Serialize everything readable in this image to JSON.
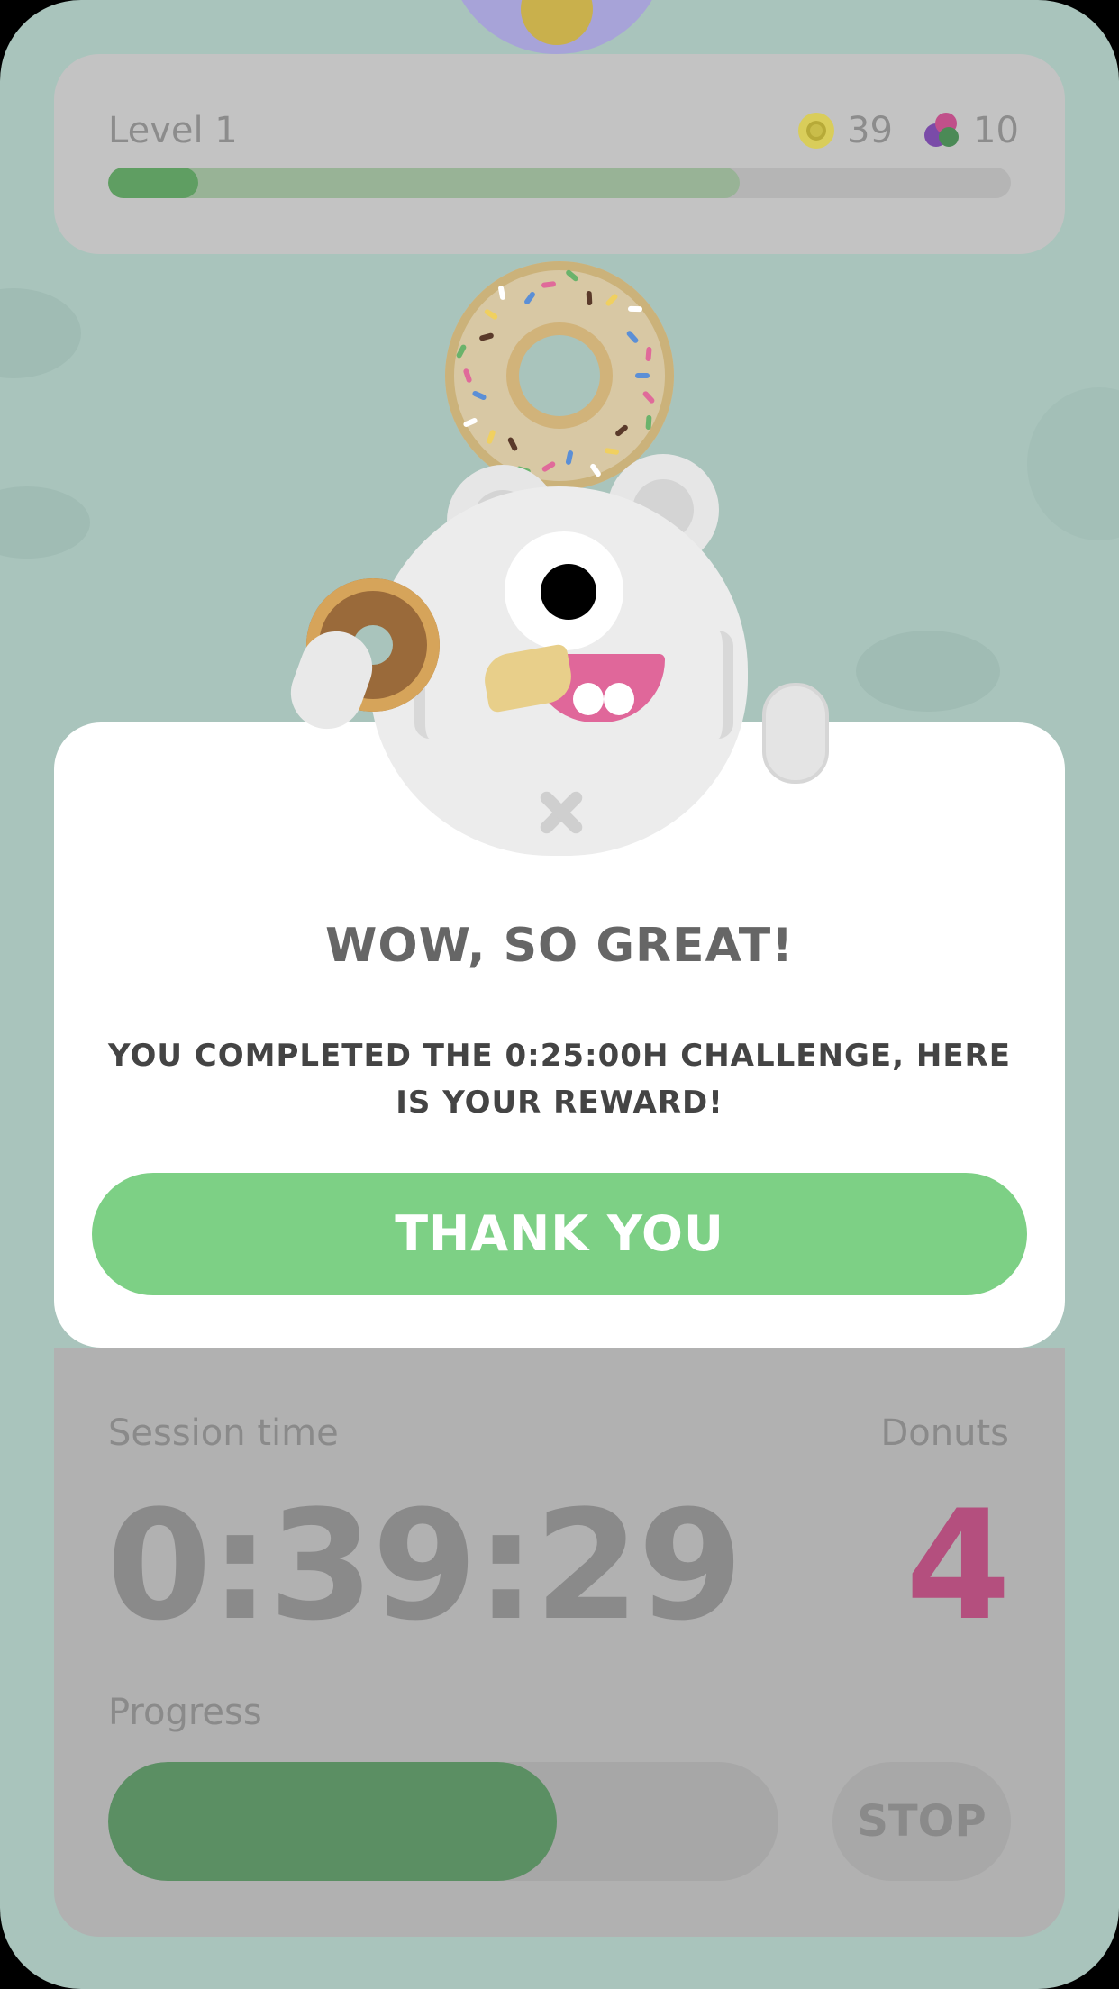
{
  "header": {
    "level_label": "Level 1",
    "coins": "39",
    "gems": "10",
    "level_progress": 0.1,
    "daily_progress": 0.7
  },
  "modal": {
    "title": "WOW, SO GREAT!",
    "message": "YOU COMPLETED THE 0:25:00H CHALLENGE, HERE IS YOUR REWARD!",
    "button_label": "THANK YOU"
  },
  "session": {
    "time_label": "Session time",
    "time_value": "0:39:29",
    "donuts_label": "Donuts",
    "donuts_value": "4",
    "progress_label": "Progress",
    "progress": 0.67,
    "stop_label": "STOP"
  },
  "colors": {
    "accent_green": "#7dd085",
    "donut_count": "#b44f7e",
    "background": "#a9c4bc"
  },
  "icons": {
    "coin": "coin-icon",
    "gem": "gem-icon",
    "mascot": "mascot-illustration",
    "donut": "donut-icon"
  }
}
